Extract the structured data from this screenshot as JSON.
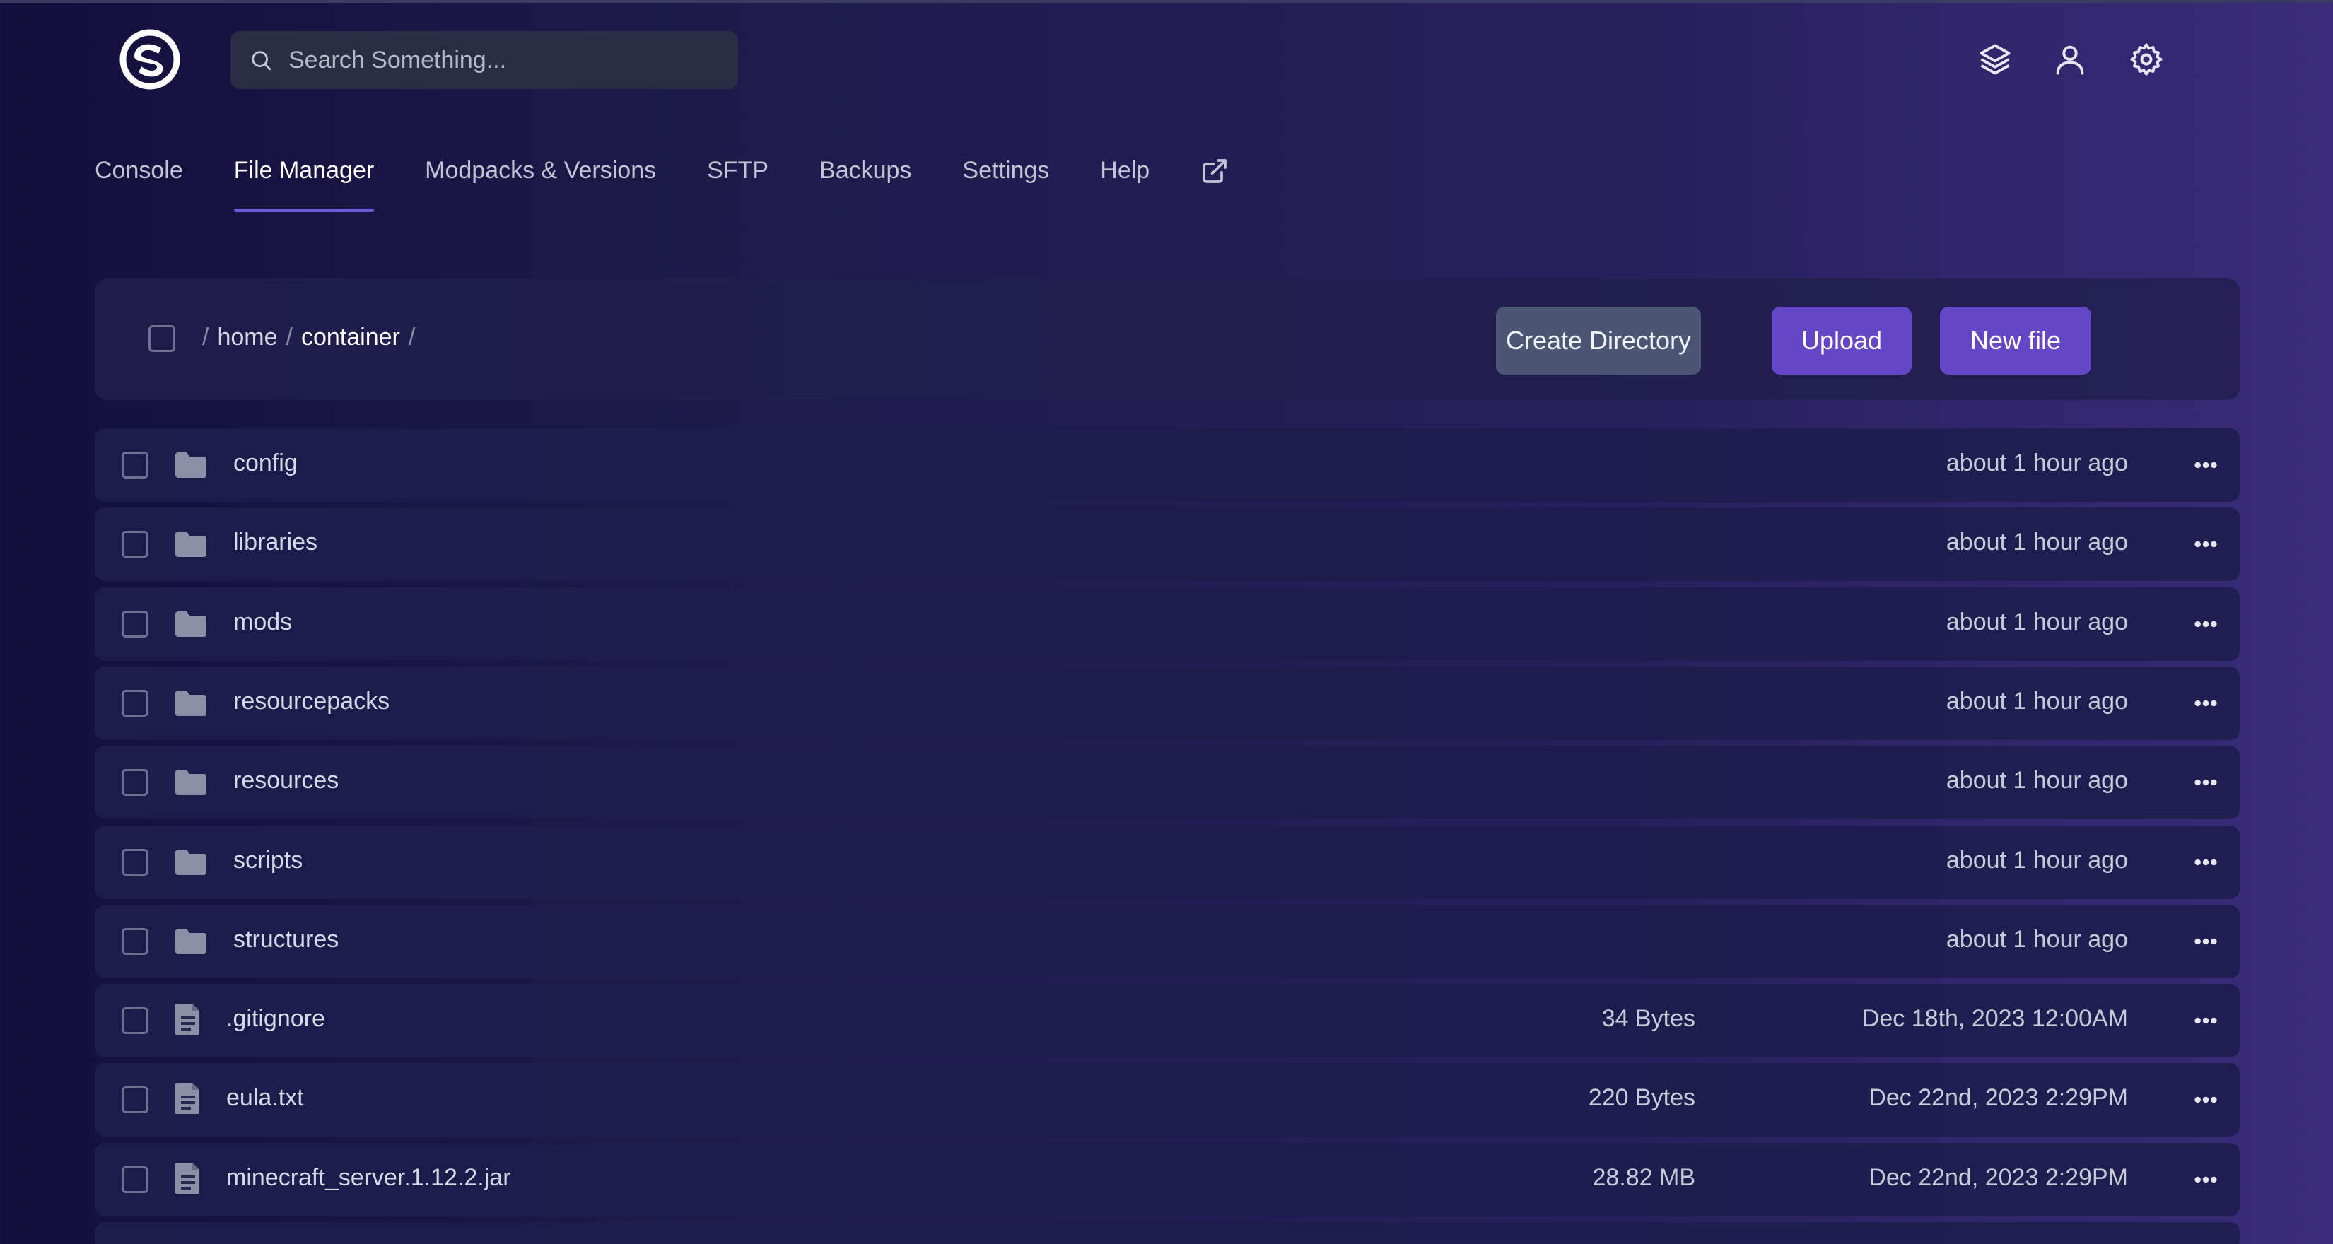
{
  "header": {
    "search_placeholder": "Search Something..."
  },
  "nav": {
    "items": [
      "Console",
      "File Manager",
      "Modpacks & Versions",
      "SFTP",
      "Backups",
      "Settings",
      "Help"
    ],
    "active": "File Manager"
  },
  "breadcrumb": {
    "root_sep": "/",
    "segments": [
      "home",
      "container"
    ],
    "trailing_sep": "/"
  },
  "toolbar": {
    "create_dir_label": "Create Directory",
    "upload_label": "Upload",
    "new_file_label": "New file"
  },
  "files": [
    {
      "name": "config",
      "type": "folder",
      "size": "",
      "modified": "about 1 hour ago"
    },
    {
      "name": "libraries",
      "type": "folder",
      "size": "",
      "modified": "about 1 hour ago"
    },
    {
      "name": "mods",
      "type": "folder",
      "size": "",
      "modified": "about 1 hour ago"
    },
    {
      "name": "resourcepacks",
      "type": "folder",
      "size": "",
      "modified": "about 1 hour ago"
    },
    {
      "name": "resources",
      "type": "folder",
      "size": "",
      "modified": "about 1 hour ago"
    },
    {
      "name": "scripts",
      "type": "folder",
      "size": "",
      "modified": "about 1 hour ago"
    },
    {
      "name": "structures",
      "type": "folder",
      "size": "",
      "modified": "about 1 hour ago"
    },
    {
      "name": ".gitignore",
      "type": "file",
      "size": "34 Bytes",
      "modified": "Dec 18th, 2023 12:00AM"
    },
    {
      "name": "eula.txt",
      "type": "file",
      "size": "220 Bytes",
      "modified": "Dec 22nd, 2023 2:29PM"
    },
    {
      "name": "minecraft_server.1.12.2.jar",
      "type": "file",
      "size": "28.82 MB",
      "modified": "Dec 22nd, 2023 2:29PM"
    }
  ],
  "colors": {
    "accent": "#6347c7",
    "secondary_button": "#4a5674",
    "background_start": "#130f3c",
    "background_end": "#3a2c7a"
  },
  "icons": {
    "header": [
      "layers-icon",
      "user-icon",
      "gear-icon"
    ],
    "nav_external": "external-link-icon",
    "folder": "folder-icon",
    "file": "file-icon",
    "row_menu": "ellipsis-icon"
  }
}
